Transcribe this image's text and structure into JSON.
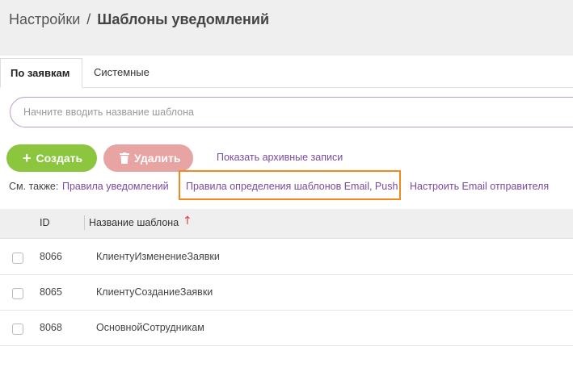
{
  "breadcrumb": {
    "root": "Настройки",
    "separator": "/",
    "current": "Шаблоны уведомлений"
  },
  "tabs": [
    {
      "label": "По заявкам",
      "active": true
    },
    {
      "label": "Системные",
      "active": false
    }
  ],
  "search": {
    "placeholder": "Начните вводить название шаблона",
    "value": ""
  },
  "toolbar": {
    "create_label": "Создать",
    "delete_label": "Удалить",
    "archive_label": "Показать архивные записи"
  },
  "see_also": {
    "label": "См. также:",
    "links": [
      "Правила уведомлений",
      "Правила определения шаблонов Email, Push",
      "Настроить Email отправителя"
    ]
  },
  "table": {
    "columns": [
      "ID",
      "Название шаблона"
    ],
    "sort_icon": "arrow-up-icon",
    "rows": [
      {
        "id": "8066",
        "name": "КлиентуИзменениеЗаявки"
      },
      {
        "id": "8065",
        "name": "КлиентуСозданиеЗаявки"
      },
      {
        "id": "8068",
        "name": "ОсновнойСотрудникам"
      }
    ]
  },
  "colors": {
    "create_button": "#8cc63f",
    "delete_button": "#e8a3a3",
    "link": "#7a4a9e",
    "highlight": "#f08a1c",
    "sort_arrow": "#e33c3c"
  }
}
